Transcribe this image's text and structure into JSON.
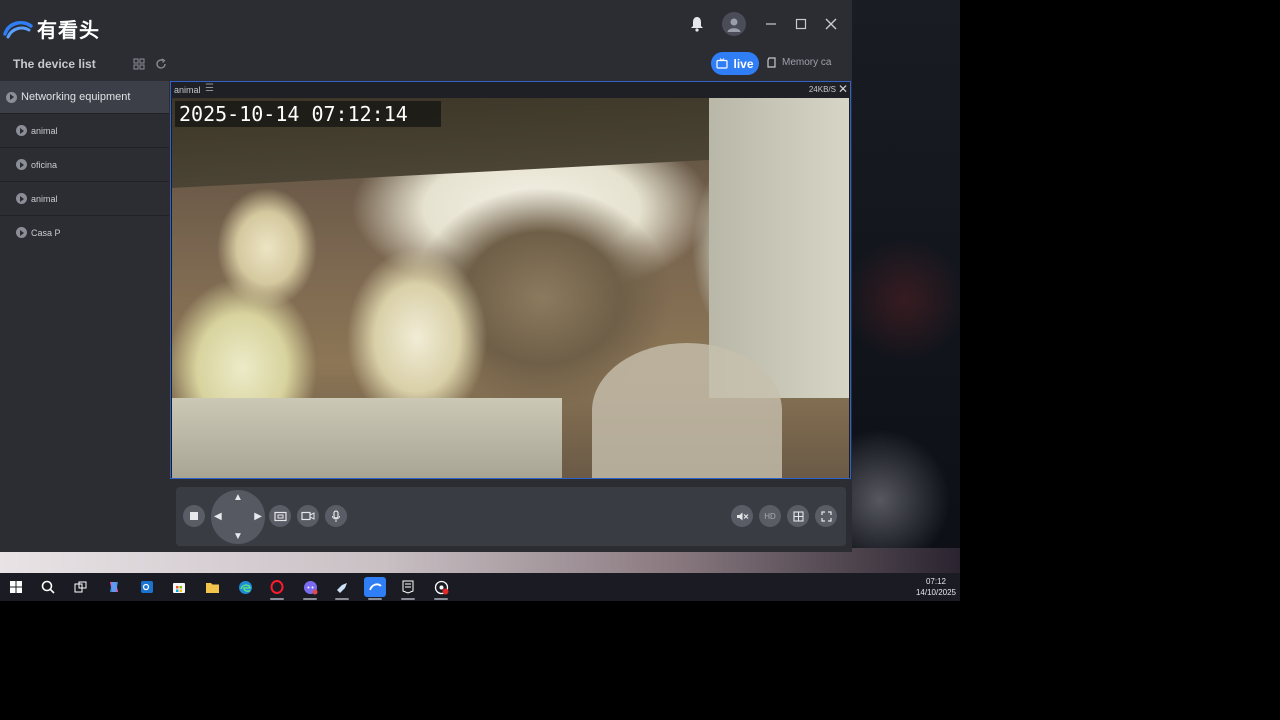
{
  "app": {
    "name": "有看头",
    "device_list_title": "The device list",
    "tabs": {
      "live_label": "live",
      "memory_label": "Memory ca"
    }
  },
  "sidebar": {
    "group_label": "Networking equipment",
    "items": [
      {
        "label": "animal"
      },
      {
        "label": "oficina"
      },
      {
        "label": "animal"
      },
      {
        "label": "Casa P"
      }
    ]
  },
  "video": {
    "name": "animal",
    "bitrate": "24KB/S",
    "timestamp": "2025-10-14  07:12:14"
  },
  "controls": {
    "quality_label": "HD"
  },
  "taskbar": {
    "time": "07:12",
    "date": "14/10/2025"
  },
  "colors": {
    "accent": "#2f7ef6",
    "window_bg": "#2b2d33",
    "sidebar_selected": "#3c3f47",
    "video_border": "#2f63c8"
  }
}
